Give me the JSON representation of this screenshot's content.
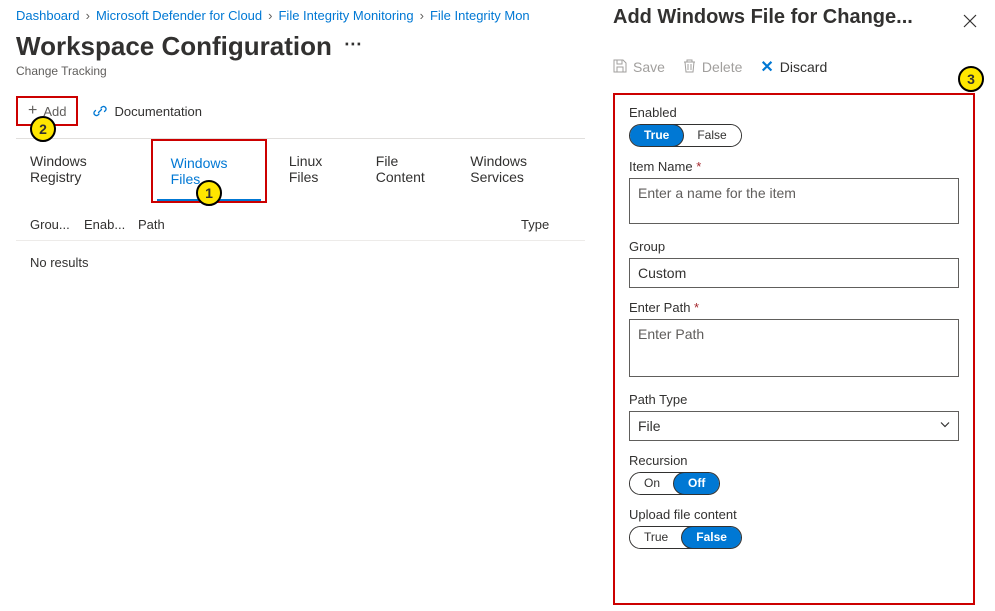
{
  "breadcrumb": [
    "Dashboard",
    "Microsoft Defender for Cloud",
    "File Integrity Monitoring",
    "File Integrity Mon"
  ],
  "page": {
    "title": "Workspace Configuration",
    "subtitle": "Change Tracking"
  },
  "toolbar": {
    "add_label": "Add",
    "doc_label": "Documentation"
  },
  "tabs": [
    "Windows Registry",
    "Windows Files",
    "Linux Files",
    "File Content",
    "Windows Services"
  ],
  "active_tab_index": 1,
  "table": {
    "columns": {
      "group": "Grou...",
      "enabled": "Enab...",
      "path": "Path",
      "type": "Type"
    },
    "empty_text": "No results"
  },
  "panel": {
    "title": "Add Windows File for Change...",
    "buttons": {
      "save": "Save",
      "delete": "Delete",
      "discard": "Discard"
    },
    "fields": {
      "enabled_label": "Enabled",
      "enabled_options": {
        "true": "True",
        "false": "False"
      },
      "item_name_label": "Item Name",
      "item_name_ph": "Enter a name for the item",
      "group_label": "Group",
      "group_value": "Custom",
      "enter_path_label": "Enter Path",
      "enter_path_ph": "Enter Path",
      "path_type_label": "Path Type",
      "path_type_value": "File",
      "recursion_label": "Recursion",
      "recursion_options": {
        "on": "On",
        "off": "Off"
      },
      "upload_label": "Upload file content",
      "upload_options": {
        "true": "True",
        "false": "False"
      }
    }
  },
  "markers": {
    "m1": "1",
    "m2": "2",
    "m3": "3"
  }
}
